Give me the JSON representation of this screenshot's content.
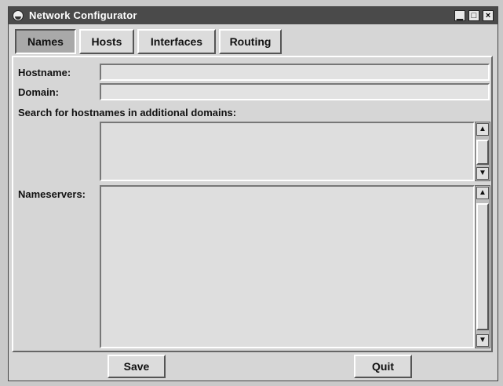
{
  "window": {
    "title": "Network Configurator",
    "minimize_glyph": "▁",
    "maximize_glyph": "□",
    "close_glyph": "×"
  },
  "tabs": [
    {
      "label": "Names",
      "active": true
    },
    {
      "label": "Hosts",
      "active": false
    },
    {
      "label": "Interfaces",
      "active": false
    },
    {
      "label": "Routing",
      "active": false
    }
  ],
  "form": {
    "hostname_label": "Hostname:",
    "hostname_value": "",
    "domain_label": "Domain:",
    "domain_value": "",
    "search_label": "Search for hostnames in additional domains:",
    "search_value": "",
    "nameservers_label": "Nameservers:",
    "nameservers_value": ""
  },
  "buttons": {
    "save_label": "Save",
    "quit_label": "Quit"
  },
  "scroll_glyphs": {
    "up": "▲",
    "down": "▼"
  }
}
